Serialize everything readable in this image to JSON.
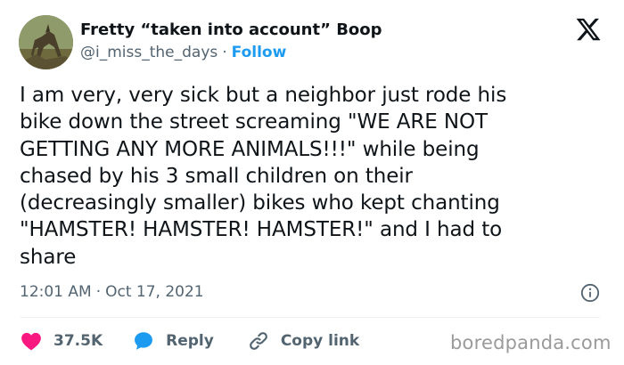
{
  "author": {
    "display_name": "Fretty “taken into account” Boop",
    "handle": "@i_miss_the_days",
    "separator": "·",
    "follow_label": "Follow"
  },
  "tweet": {
    "text_lines": [
      "I am very, very sick but a neighbor just rode his",
      "bike down the street screaming \"WE ARE NOT",
      "GETTING ANY MORE ANIMALS!!!\" while being",
      "chased by his 3 small children on their",
      "(decreasingly smaller) bikes who kept chanting",
      "\"HAMSTER! HAMSTER! HAMSTER!\" and I had to",
      "share"
    ],
    "time": "12:01 AM",
    "separator": "·",
    "date": "Oct 17, 2021"
  },
  "actions": {
    "like_count": "37.5K",
    "reply_label": "Reply",
    "copy_link_label": "Copy link"
  },
  "watermark": "boredpanda.com",
  "colors": {
    "text": "#0f1419",
    "secondary": "#536471",
    "accent": "#1d9bf0",
    "like": "#f91880",
    "reply": "#1d9bf0"
  },
  "icons": {
    "logo": "x-logo-icon",
    "info": "info-icon",
    "like": "heart-icon",
    "reply": "speech-bubble-icon",
    "copy_link": "link-icon"
  }
}
